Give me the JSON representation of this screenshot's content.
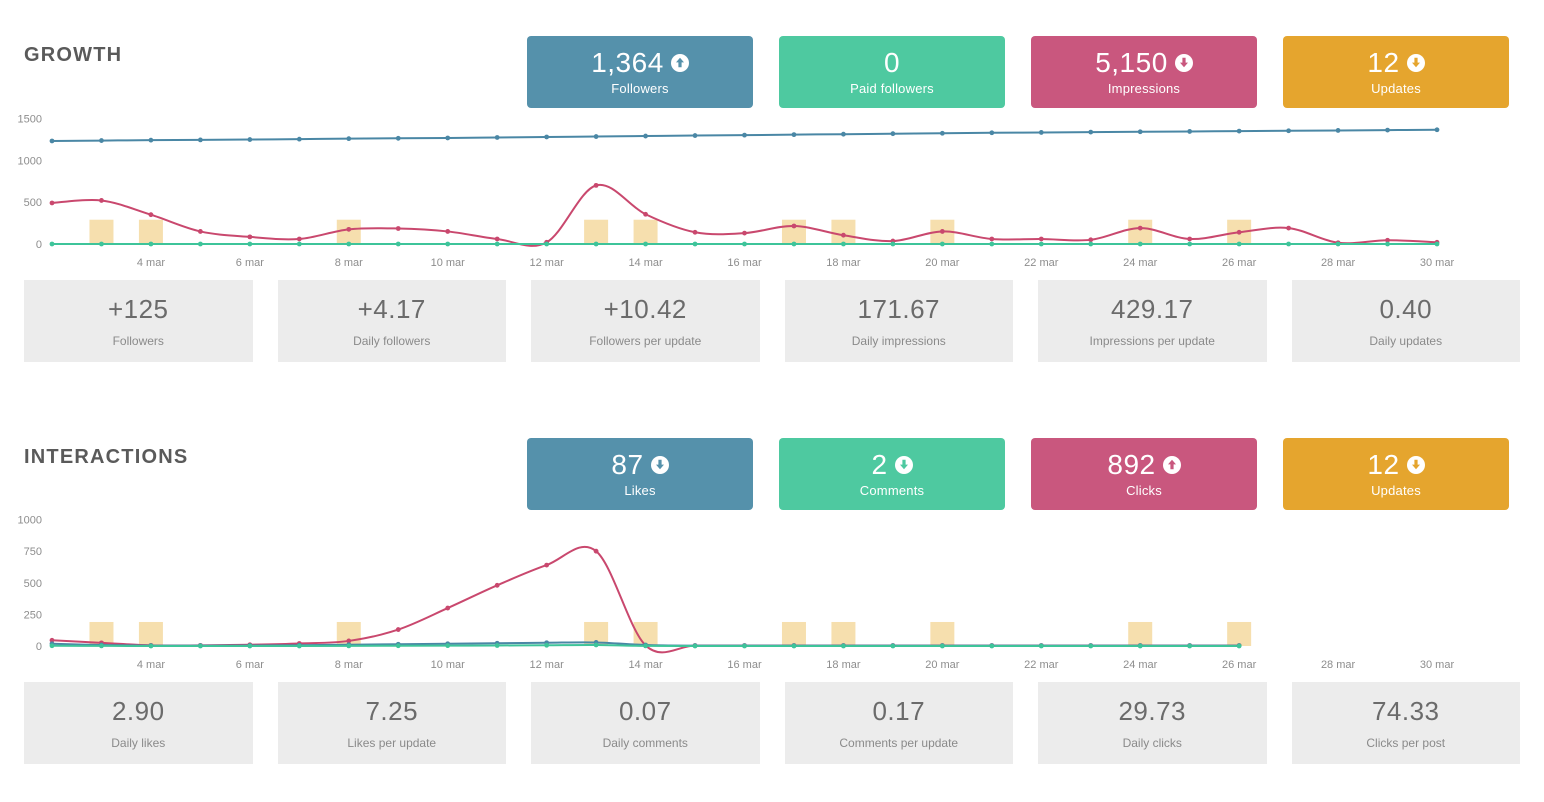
{
  "sections": [
    {
      "title": "GROWTH",
      "kpis": [
        {
          "value": "1,364",
          "label": "Followers",
          "color": "#5591ab",
          "trend": "up"
        },
        {
          "value": "0",
          "label": "Paid followers",
          "color": "#4ec9a0",
          "trend": "none"
        },
        {
          "value": "5,150",
          "label": "Impressions",
          "color": "#c9577e",
          "trend": "down"
        },
        {
          "value": "12",
          "label": "Updates",
          "color": "#e5a52e",
          "trend": "down"
        }
      ],
      "stats": [
        {
          "value": "+125",
          "label": "Followers"
        },
        {
          "value": "+4.17",
          "label": "Daily followers"
        },
        {
          "value": "+10.42",
          "label": "Followers per update"
        },
        {
          "value": "171.67",
          "label": "Daily impressions"
        },
        {
          "value": "429.17",
          "label": "Impressions per update"
        },
        {
          "value": "0.40",
          "label": "Daily updates"
        }
      ]
    },
    {
      "title": "INTERACTIONS",
      "kpis": [
        {
          "value": "87",
          "label": "Likes",
          "color": "#5591ab",
          "trend": "down"
        },
        {
          "value": "2",
          "label": "Comments",
          "color": "#4ec9a0",
          "trend": "down"
        },
        {
          "value": "892",
          "label": "Clicks",
          "color": "#c9577e",
          "trend": "up"
        },
        {
          "value": "12",
          "label": "Updates",
          "color": "#e5a52e",
          "trend": "down"
        }
      ],
      "stats": [
        {
          "value": "2.90",
          "label": "Daily likes"
        },
        {
          "value": "7.25",
          "label": "Likes per update"
        },
        {
          "value": "0.07",
          "label": "Daily comments"
        },
        {
          "value": "0.17",
          "label": "Comments per update"
        },
        {
          "value": "29.73",
          "label": "Daily clicks"
        },
        {
          "value": "74.33",
          "label": "Clicks per post"
        }
      ]
    }
  ],
  "chart_data": [
    {
      "type": "line",
      "id": "growth-chart",
      "title": "Growth",
      "xlabel": "",
      "ylabel": "",
      "ylim": [
        0,
        1600
      ],
      "yticks": [
        0,
        500,
        1000,
        1500
      ],
      "ytick_labels": [
        "0",
        "500",
        "1000",
        "1500"
      ],
      "x": [
        "2 mar",
        "3 mar",
        "4 mar",
        "5 mar",
        "6 mar",
        "7 mar",
        "8 mar",
        "9 mar",
        "10 mar",
        "11 mar",
        "12 mar",
        "13 mar",
        "14 mar",
        "15 mar",
        "16 mar",
        "17 mar",
        "18 mar",
        "19 mar",
        "20 mar",
        "21 mar",
        "22 mar",
        "23 mar",
        "24 mar",
        "25 mar",
        "26 mar",
        "27 mar",
        "28 mar",
        "29 mar",
        "30 mar"
      ],
      "xtick_labels": [
        "4 mar",
        "6 mar",
        "8 mar",
        "10 mar",
        "12 mar",
        "14 mar",
        "16 mar",
        "18 mar",
        "20 mar",
        "22 mar",
        "24 mar",
        "26 mar",
        "28 mar",
        "30 mar"
      ],
      "grid": false,
      "legend": "none",
      "series": [
        {
          "name": "Followers",
          "color": "#4a87a5",
          "values": [
            1230,
            1235,
            1240,
            1243,
            1247,
            1252,
            1258,
            1262,
            1266,
            1272,
            1278,
            1283,
            1289,
            1295,
            1300,
            1306,
            1311,
            1317,
            1322,
            1328,
            1332,
            1336,
            1340,
            1344,
            1348,
            1352,
            1356,
            1360,
            1364
          ]
        },
        {
          "name": "Impressions",
          "color": "#c9486e",
          "values": [
            490,
            520,
            350,
            150,
            85,
            60,
            175,
            185,
            150,
            60,
            20,
            700,
            355,
            140,
            130,
            215,
            105,
            35,
            150,
            60,
            60,
            50,
            190,
            60,
            140,
            190,
            15,
            45,
            20
          ]
        },
        {
          "name": "Paid followers",
          "color": "#3ec49a",
          "values": [
            0,
            0,
            0,
            0,
            0,
            0,
            0,
            0,
            0,
            0,
            0,
            0,
            0,
            0,
            0,
            0,
            0,
            0,
            0,
            0,
            0,
            0,
            0,
            0,
            0,
            0,
            0,
            0,
            0
          ]
        }
      ],
      "bars": {
        "name": "Updates",
        "color": "#f6dfae",
        "height_value": 290,
        "days": [
          "3 mar",
          "4 mar",
          "8 mar",
          "13 mar",
          "14 mar",
          "17 mar",
          "18 mar",
          "20 mar",
          "24 mar",
          "26 mar"
        ]
      }
    },
    {
      "type": "line",
      "id": "interactions-chart",
      "title": "Interactions",
      "xlabel": "",
      "ylabel": "",
      "ylim": [
        0,
        1060
      ],
      "yticks": [
        0,
        250,
        500,
        750,
        1000
      ],
      "ytick_labels": [
        "0",
        "250",
        "500",
        "750",
        "1000"
      ],
      "x": [
        "2 mar",
        "3 mar",
        "4 mar",
        "5 mar",
        "6 mar",
        "7 mar",
        "8 mar",
        "9 mar",
        "10 mar",
        "11 mar",
        "12 mar",
        "13 mar",
        "14 mar",
        "15 mar",
        "16 mar",
        "17 mar",
        "18 mar",
        "19 mar",
        "20 mar",
        "21 mar",
        "22 mar",
        "23 mar",
        "24 mar",
        "25 mar",
        "26 mar"
      ],
      "xtick_labels": [
        "4 mar",
        "6 mar",
        "8 mar",
        "10 mar",
        "12 mar",
        "14 mar",
        "16 mar",
        "18 mar",
        "20 mar",
        "22 mar",
        "24 mar",
        "26 mar",
        "28 mar",
        "30 mar"
      ],
      "grid": false,
      "legend": "none",
      "series": [
        {
          "name": "Clicks",
          "color": "#c9486e",
          "values": [
            45,
            25,
            5,
            5,
            10,
            20,
            40,
            130,
            300,
            480,
            640,
            750,
            5,
            4,
            4,
            4,
            4,
            4,
            4,
            4,
            4,
            4,
            4,
            4,
            4
          ]
        },
        {
          "name": "Likes",
          "color": "#4a87a5",
          "values": [
            18,
            8,
            3,
            3,
            4,
            6,
            10,
            14,
            18,
            22,
            26,
            28,
            8,
            3,
            3,
            3,
            3,
            3,
            3,
            3,
            3,
            3,
            3,
            3,
            3
          ]
        },
        {
          "name": "Comments",
          "color": "#3ec49a",
          "values": [
            2,
            1,
            0,
            0,
            0,
            0,
            1,
            2,
            3,
            4,
            6,
            8,
            1,
            0,
            0,
            0,
            0,
            0,
            0,
            0,
            0,
            0,
            0,
            0,
            0
          ]
        }
      ],
      "bars": {
        "name": "Updates",
        "color": "#f6dfae",
        "height_value": 190,
        "days": [
          "3 mar",
          "4 mar",
          "8 mar",
          "13 mar",
          "14 mar",
          "17 mar",
          "18 mar",
          "20 mar",
          "24 mar",
          "26 mar"
        ]
      }
    }
  ]
}
